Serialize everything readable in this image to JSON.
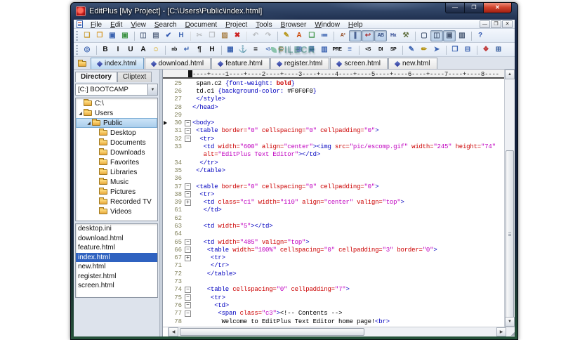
{
  "window": {
    "title": "EditPlus [My Project] - [C:\\Users\\Public\\index.html]",
    "controls": {
      "minimize": "—",
      "maximize": "❐",
      "close": "✕"
    }
  },
  "menu": {
    "items": [
      {
        "label": "File"
      },
      {
        "label": "Edit"
      },
      {
        "label": "View"
      },
      {
        "label": "Search"
      },
      {
        "label": "Document"
      },
      {
        "label": "Project"
      },
      {
        "label": "Tools"
      },
      {
        "label": "Browser"
      },
      {
        "label": "Window"
      },
      {
        "label": "Help"
      }
    ],
    "mdi_controls": [
      {
        "n": "mdi-minimize",
        "g": "—"
      },
      {
        "n": "mdi-restore",
        "g": "❐"
      },
      {
        "n": "mdi-close",
        "g": "✕"
      }
    ]
  },
  "toolbar1": {
    "buttons": [
      {
        "n": "new-file",
        "g": "❏",
        "c": "#c89a2e"
      },
      {
        "n": "open-file",
        "g": "❐",
        "c": "#d79b2f"
      },
      {
        "n": "save-file",
        "g": "▣",
        "c": "#3a62b0"
      },
      {
        "n": "save-all",
        "g": "▣",
        "c": "#3f9447"
      },
      {
        "n": "print-preview",
        "g": "◫",
        "c": "#5c6b85",
        "sep": true
      },
      {
        "n": "print",
        "g": "▤",
        "c": "#5c6b85"
      },
      {
        "n": "spell-check",
        "g": "✔",
        "c": "#2e55b0"
      },
      {
        "n": "char-encoding",
        "g": "H",
        "c": "#3a62b0"
      },
      {
        "n": "cut",
        "g": "✂",
        "c": "#707070",
        "d": true,
        "sep": true
      },
      {
        "n": "copy",
        "g": "❒",
        "c": "#707070",
        "d": true
      },
      {
        "n": "paste",
        "g": "▨",
        "c": "#a9824a"
      },
      {
        "n": "delete",
        "g": "✖",
        "c": "#cc2222"
      },
      {
        "n": "undo",
        "g": "↶",
        "c": "#707070",
        "d": true,
        "sep": true
      },
      {
        "n": "redo",
        "g": "↷",
        "c": "#707070",
        "d": true
      },
      {
        "n": "highlighter",
        "g": "✎",
        "c": "#b5920f",
        "sep": true
      },
      {
        "n": "font-color",
        "g": "A",
        "c": "#cc4400"
      },
      {
        "n": "cliptext-doc",
        "g": "❏",
        "c": "#3f9447"
      },
      {
        "n": "indent-guide",
        "g": "≔",
        "c": "#3a62b0"
      },
      {
        "n": "sort",
        "g": "A³",
        "c": "#8a3c10",
        "s": true,
        "sep": true
      },
      {
        "n": "toggle-marks",
        "g": "∥",
        "c": "#304a80",
        "p": true
      },
      {
        "n": "toggle-word-wrap",
        "g": "↩",
        "c": "#aa3333",
        "p": true
      },
      {
        "n": "toggle-auto-complete",
        "g": "AB",
        "c": "#304a80",
        "s": true,
        "p": true
      },
      {
        "n": "hex-viewer",
        "g": "Hx",
        "c": "#203a8a",
        "s": true
      },
      {
        "n": "file-tools",
        "g": "⚒",
        "c": "#607040"
      },
      {
        "n": "window-layout-1",
        "g": "▢",
        "c": "#4a5a74",
        "sep": true
      },
      {
        "n": "window-layout-2",
        "g": "◫",
        "c": "#4a5a74",
        "p": true
      },
      {
        "n": "window-layout-3",
        "g": "▣",
        "c": "#4a5a74",
        "p": true
      },
      {
        "n": "window-layout-4",
        "g": "▥",
        "c": "#4a5a74"
      },
      {
        "n": "context-help",
        "g": "?",
        "c": "#2e55b0",
        "sep": true
      }
    ]
  },
  "toolbar2": {
    "buttons": [
      {
        "n": "browser-preview",
        "g": "◎",
        "c": "#3a62b0"
      },
      {
        "n": "bold",
        "g": "B",
        "c": "#111111",
        "sep": true
      },
      {
        "n": "italic",
        "g": "I",
        "c": "#111111"
      },
      {
        "n": "underline",
        "g": "U",
        "c": "#111111"
      },
      {
        "n": "font-tag",
        "g": "A",
        "c": "#111111"
      },
      {
        "n": "smiley",
        "g": "☺",
        "c": "#d9a50f"
      },
      {
        "n": "non-breaking-space",
        "g": "nb",
        "c": "#111111",
        "s": true,
        "sep": true
      },
      {
        "n": "line-break",
        "g": "↵",
        "c": "#3a62b0"
      },
      {
        "n": "paragraph-tag",
        "g": "¶",
        "c": "#111111"
      },
      {
        "n": "heading-tag",
        "g": "H",
        "c": "#111111"
      },
      {
        "n": "image-tag",
        "g": "▦",
        "c": "#3a62b0",
        "sep": true
      },
      {
        "n": "anchor-tag",
        "g": "⚓",
        "c": "#2e55b0"
      },
      {
        "n": "horizontal-rule",
        "g": "=",
        "c": "#111111"
      },
      {
        "n": "comment-tag",
        "g": "<!-",
        "c": "#3a62b0",
        "s": true
      },
      {
        "n": "special-char",
        "g": "©",
        "c": "#b5730f"
      },
      {
        "n": "table-tag",
        "g": "⊞",
        "c": "#3a62b0",
        "sep": true
      },
      {
        "n": "table-row-tag",
        "g": "≣",
        "c": "#3a62b0"
      },
      {
        "n": "table-col-tag",
        "g": "▥",
        "c": "#3a62b0"
      },
      {
        "n": "pre-tag",
        "g": "PRE",
        "c": "#111111",
        "s": true
      },
      {
        "n": "list-tag",
        "g": "≡",
        "c": "#3a62b0"
      },
      {
        "n": "strong-tag",
        "g": "<S",
        "c": "#111111",
        "s": true,
        "sep": true
      },
      {
        "n": "div-tag",
        "g": "DI",
        "c": "#111111",
        "s": true
      },
      {
        "n": "span-tag",
        "g": "SP",
        "c": "#111111",
        "s": true
      },
      {
        "n": "edit-source",
        "g": "✎",
        "c": "#3a62b0",
        "sep": true
      },
      {
        "n": "cliptext-edit",
        "g": "✏",
        "c": "#b5920f"
      },
      {
        "n": "user-tools",
        "g": "➤",
        "c": "#3a62b0"
      },
      {
        "n": "new-window",
        "g": "❐",
        "c": "#3a62b0",
        "sep": true
      },
      {
        "n": "split-window",
        "g": "⊟",
        "c": "#3a62b0"
      },
      {
        "n": "color-picker",
        "g": "❖",
        "c": "#c03a3a",
        "sep": true
      },
      {
        "n": "frameset",
        "g": "⊞",
        "c": "#30589a"
      }
    ]
  },
  "tabs": {
    "items": [
      {
        "label": "index.html",
        "active": true
      },
      {
        "label": "download.html"
      },
      {
        "label": "feature.html"
      },
      {
        "label": "register.html"
      },
      {
        "label": "screen.html"
      },
      {
        "label": "new.html"
      }
    ]
  },
  "sidebar": {
    "tabs": [
      {
        "label": "Directory",
        "active": true
      },
      {
        "label": "Cliptext"
      }
    ],
    "drive_selector": {
      "value": "[C:] BOOTCAMP"
    },
    "tree": {
      "items": [
        {
          "label": "C:\\",
          "level": 0
        },
        {
          "label": "Users",
          "level": 0,
          "arrow": true
        },
        {
          "label": "Public",
          "level": 1,
          "arrow": true,
          "selected": true
        },
        {
          "label": "Desktop",
          "level": 2
        },
        {
          "label": "Documents",
          "level": 2
        },
        {
          "label": "Downloads",
          "level": 2
        },
        {
          "label": "Favorites",
          "level": 2
        },
        {
          "label": "Libraries",
          "level": 2
        },
        {
          "label": "Music",
          "level": 2
        },
        {
          "label": "Pictures",
          "level": 2
        },
        {
          "label": "Recorded TV",
          "level": 2
        },
        {
          "label": "Videos",
          "level": 2
        }
      ]
    },
    "files": {
      "items": [
        {
          "label": "desktop.ini"
        },
        {
          "label": "download.html"
        },
        {
          "label": "feature.html"
        },
        {
          "label": "index.html",
          "selected": true
        },
        {
          "label": "new.html"
        },
        {
          "label": "register.html"
        },
        {
          "label": "screen.html"
        }
      ]
    }
  },
  "editor": {
    "ruler": "----+----1----+----2----+----3----+----4----+----5----+----6----+----7----+----8----",
    "lines": [
      {
        "n": "25",
        "f": "",
        "m": false,
        "t": [
          [
            "k",
            " span.c2 "
          ],
          [
            "g",
            "{font-weight: "
          ],
          [
            "r",
            "bold"
          ],
          [
            "g",
            "}"
          ]
        ]
      },
      {
        "n": "26",
        "f": "",
        "m": false,
        "t": [
          [
            "k",
            " td.c1 "
          ],
          [
            "g",
            "{background-color: "
          ],
          [
            "k",
            "#F0F0F0"
          ],
          [
            "g",
            "}"
          ]
        ]
      },
      {
        "n": "27",
        "f": "",
        "m": false,
        "t": [
          [
            "g",
            " </style>"
          ]
        ]
      },
      {
        "n": "28",
        "f": "",
        "m": false,
        "t": [
          [
            "g",
            "</head>"
          ]
        ]
      },
      {
        "n": "29",
        "f": "",
        "m": false,
        "t": []
      },
      {
        "n": "30",
        "f": "o",
        "m": true,
        "t": [
          [
            "g",
            "<body>"
          ]
        ]
      },
      {
        "n": "31",
        "f": "o",
        "m": false,
        "t": [
          [
            "g",
            " <table "
          ],
          [
            "a",
            "border="
          ],
          [
            "v",
            "\"0\" "
          ],
          [
            "a",
            "cellspacing="
          ],
          [
            "v",
            "\"0\" "
          ],
          [
            "a",
            "cellpadding="
          ],
          [
            "v",
            "\"0\""
          ],
          [
            "g",
            ">"
          ]
        ]
      },
      {
        "n": "32",
        "f": "o",
        "m": false,
        "t": [
          [
            "g",
            "  <tr>"
          ]
        ]
      },
      {
        "n": "33",
        "f": "",
        "m": false,
        "t": [
          [
            "g",
            "   <td "
          ],
          [
            "a",
            "width="
          ],
          [
            "v",
            "\"600\" "
          ],
          [
            "a",
            "align="
          ],
          [
            "v",
            "\"center\""
          ],
          [
            "g",
            "><img "
          ],
          [
            "a",
            "src="
          ],
          [
            "v",
            "\"pic/escomp.gif\" "
          ],
          [
            "a",
            "width="
          ],
          [
            "v",
            "\"245\" "
          ],
          [
            "a",
            "height="
          ],
          [
            "v",
            "\"74\""
          ]
        ]
      },
      {
        "n": "",
        "f": "",
        "m": false,
        "t": [
          [
            "g",
            "   "
          ],
          [
            "a",
            "alt="
          ],
          [
            "v",
            "\"EditPlus Text Editor\""
          ],
          [
            "g",
            "></td>"
          ]
        ]
      },
      {
        "n": "34",
        "f": "",
        "m": false,
        "t": [
          [
            "g",
            "  </tr>"
          ]
        ]
      },
      {
        "n": "35",
        "f": "",
        "m": false,
        "t": [
          [
            "g",
            " </table>"
          ]
        ]
      },
      {
        "n": "36",
        "f": "",
        "m": false,
        "t": []
      },
      {
        "n": "37",
        "f": "o",
        "m": false,
        "t": [
          [
            "g",
            " <table "
          ],
          [
            "a",
            "border="
          ],
          [
            "v",
            "\"0\" "
          ],
          [
            "a",
            "cellspacing="
          ],
          [
            "v",
            "\"0\" "
          ],
          [
            "a",
            "cellpadding="
          ],
          [
            "v",
            "\"0\""
          ],
          [
            "g",
            ">"
          ]
        ]
      },
      {
        "n": "38",
        "f": "o",
        "m": false,
        "t": [
          [
            "g",
            "  <tr>"
          ]
        ]
      },
      {
        "n": "39",
        "f": "c",
        "m": false,
        "t": [
          [
            "g",
            "   <td "
          ],
          [
            "a",
            "class="
          ],
          [
            "v",
            "\"c1\" "
          ],
          [
            "a",
            "width="
          ],
          [
            "v",
            "\"110\" "
          ],
          [
            "a",
            "align="
          ],
          [
            "v",
            "\"center\" "
          ],
          [
            "a",
            "valign="
          ],
          [
            "v",
            "\"top\""
          ],
          [
            "g",
            ">"
          ]
        ]
      },
      {
        "n": "61",
        "f": "",
        "m": false,
        "t": [
          [
            "g",
            "   </td>"
          ]
        ]
      },
      {
        "n": "62",
        "f": "",
        "m": false,
        "t": []
      },
      {
        "n": "63",
        "f": "",
        "m": false,
        "t": [
          [
            "g",
            "   <td "
          ],
          [
            "a",
            "width="
          ],
          [
            "v",
            "\"5\""
          ],
          [
            "g",
            "></td>"
          ]
        ]
      },
      {
        "n": "64",
        "f": "",
        "m": false,
        "t": []
      },
      {
        "n": "65",
        "f": "o",
        "m": false,
        "t": [
          [
            "g",
            "   <td "
          ],
          [
            "a",
            "width="
          ],
          [
            "v",
            "\"485\" "
          ],
          [
            "a",
            "valign="
          ],
          [
            "v",
            "\"top\""
          ],
          [
            "g",
            ">"
          ]
        ]
      },
      {
        "n": "66",
        "f": "o",
        "m": false,
        "t": [
          [
            "g",
            "    <table "
          ],
          [
            "a",
            "width="
          ],
          [
            "v",
            "\"100%\" "
          ],
          [
            "a",
            "cellspacing="
          ],
          [
            "v",
            "\"0\" "
          ],
          [
            "a",
            "cellpadding="
          ],
          [
            "v",
            "\"3\" "
          ],
          [
            "a",
            "border="
          ],
          [
            "v",
            "\"0\""
          ],
          [
            "g",
            ">"
          ]
        ]
      },
      {
        "n": "67",
        "f": "c",
        "m": false,
        "t": [
          [
            "g",
            "     <tr>"
          ]
        ]
      },
      {
        "n": "71",
        "f": "",
        "m": false,
        "t": [
          [
            "g",
            "     </tr>"
          ]
        ]
      },
      {
        "n": "72",
        "f": "",
        "m": false,
        "t": [
          [
            "g",
            "    </table>"
          ]
        ]
      },
      {
        "n": "73",
        "f": "",
        "m": false,
        "t": []
      },
      {
        "n": "74",
        "f": "o",
        "m": false,
        "t": [
          [
            "g",
            "    <table "
          ],
          [
            "a",
            "cellspacing="
          ],
          [
            "v",
            "\"0\" "
          ],
          [
            "a",
            "cellpadding="
          ],
          [
            "v",
            "\"7\""
          ],
          [
            "g",
            ">"
          ]
        ]
      },
      {
        "n": "75",
        "f": "o",
        "m": false,
        "t": [
          [
            "g",
            "     <tr>"
          ]
        ]
      },
      {
        "n": "76",
        "f": "o",
        "m": false,
        "t": [
          [
            "g",
            "      <td>"
          ]
        ]
      },
      {
        "n": "77",
        "f": "o",
        "m": false,
        "t": [
          [
            "g",
            "       <span "
          ],
          [
            "a",
            "class="
          ],
          [
            "v",
            "\"c3\""
          ],
          [
            "g",
            ">"
          ],
          [
            "m2",
            "<!-- Contents -->"
          ]
        ]
      },
      {
        "n": "78",
        "f": "",
        "m": false,
        "t": [
          [
            "k",
            "        Welcome to EditPlus Text Editor home page!"
          ],
          [
            "g",
            "<br>"
          ]
        ]
      }
    ]
  },
  "scroll": {
    "up": "▲",
    "down": "▼",
    "left": "◀",
    "right": "▶",
    "grip": "◢"
  },
  "watermark": {
    "text": "FILECR"
  }
}
